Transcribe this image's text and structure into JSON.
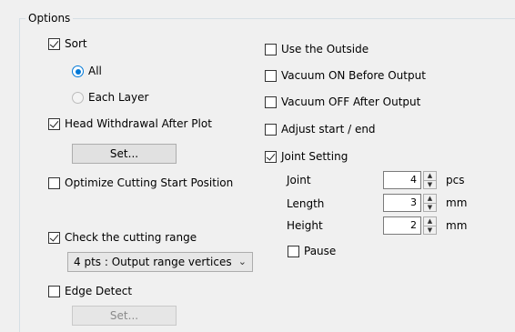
{
  "options_group": {
    "title": "Options"
  },
  "left": {
    "sort": {
      "label": "Sort",
      "checked": true
    },
    "sort_options": [
      {
        "label": "All",
        "selected": true
      },
      {
        "label": "Each Layer",
        "selected": false
      }
    ],
    "head_withdrawal": {
      "label": "Head Withdrawal After Plot",
      "checked": true
    },
    "set_button_1": "Set...",
    "optimize_start": {
      "label": "Optimize Cutting Start Position",
      "checked": false
    },
    "check_range": {
      "label": "Check the cutting range",
      "checked": true
    },
    "range_select": {
      "value": "4 pts : Output range vertices"
    },
    "edge_detect": {
      "label": "Edge Detect",
      "checked": false
    },
    "set_button_2": "Set..."
  },
  "right": {
    "use_outside": {
      "label": "Use the Outside",
      "checked": false
    },
    "vacuum_on": {
      "label": "Vacuum ON Before Output",
      "checked": false
    },
    "vacuum_off": {
      "label": "Vacuum OFF After Output",
      "checked": false
    },
    "adjust_start_end": {
      "label": "Adjust start / end",
      "checked": false
    },
    "joint_setting": {
      "label": "Joint Setting",
      "checked": true
    },
    "joint": {
      "label": "Joint",
      "value": "4",
      "unit": "pcs"
    },
    "length": {
      "label": "Length",
      "value": "3",
      "unit": "mm"
    },
    "height": {
      "label": "Height",
      "value": "2",
      "unit": "mm"
    },
    "pause": {
      "label": "Pause",
      "checked": false
    }
  },
  "icons": {
    "checkbox-checked": "check glyph",
    "radio-selected": "filled dot",
    "dropdown": "chevron-down-icon",
    "spin-up": "up-arrow-icon",
    "spin-down": "down-arrow-icon"
  },
  "colors": {
    "background": "#f0f0f0",
    "accent": "#0078d7",
    "group_border": "#d5dfe5"
  }
}
